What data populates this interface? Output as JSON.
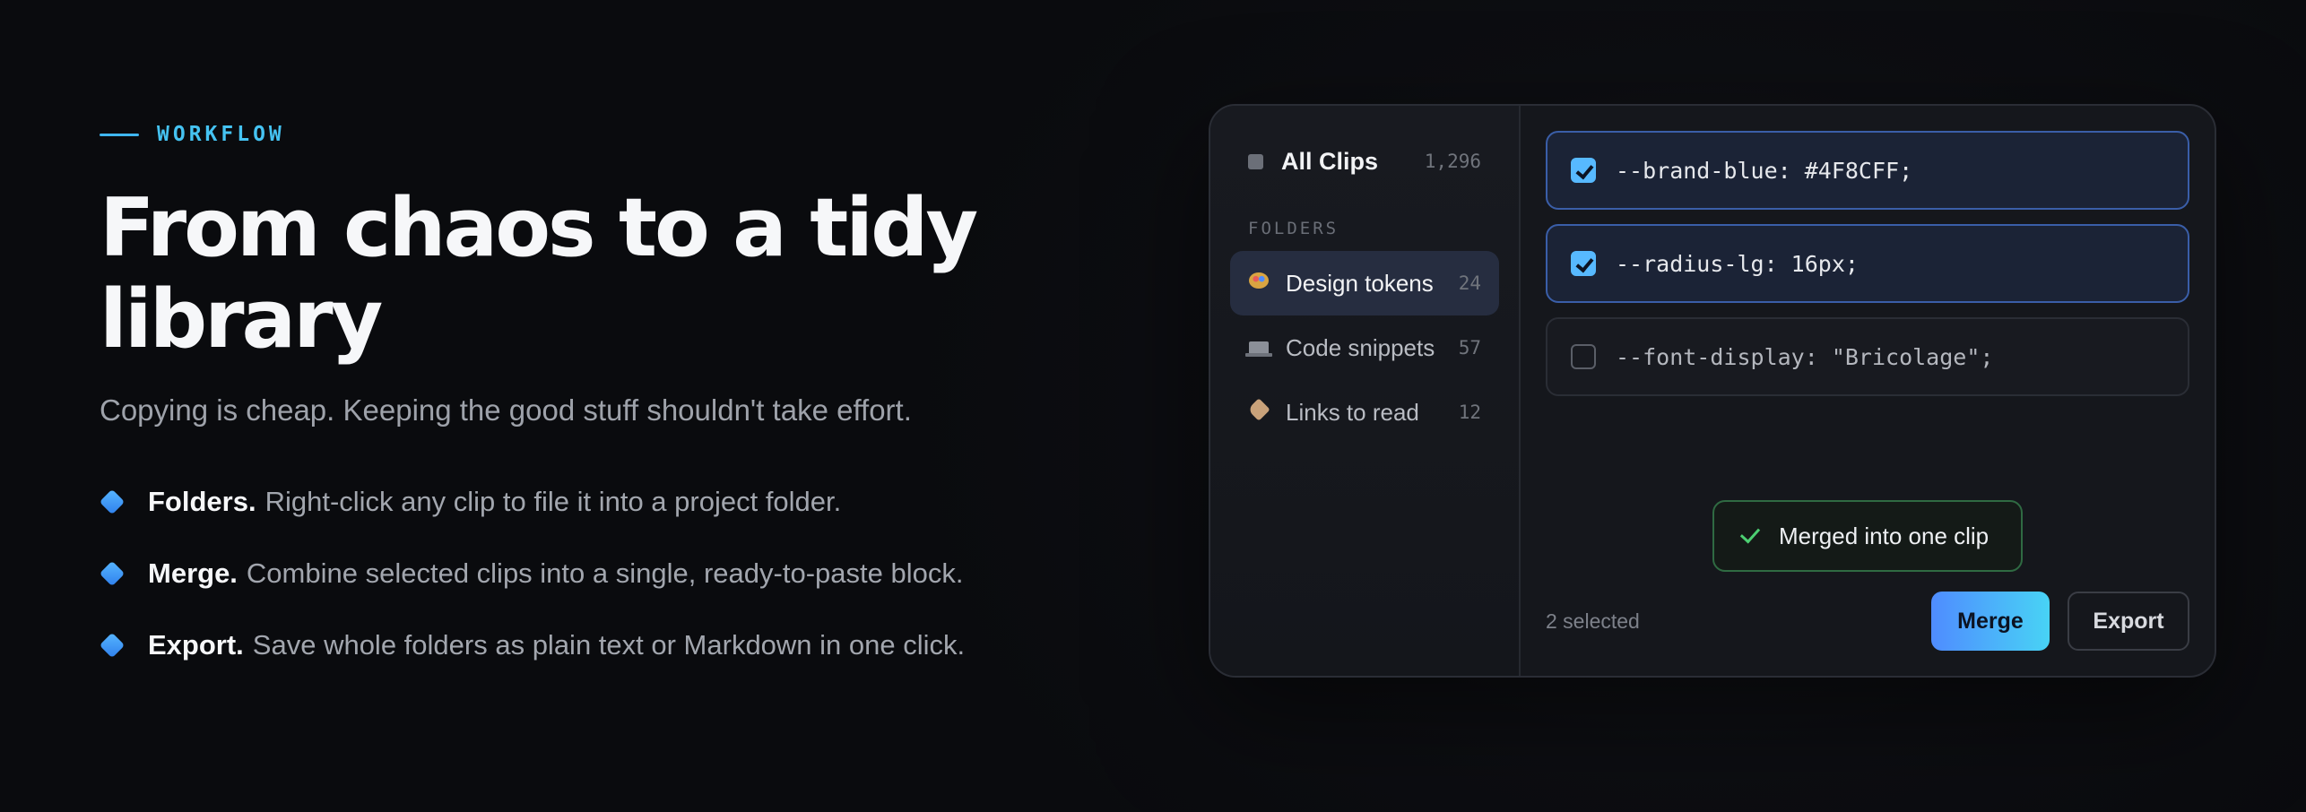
{
  "copy": {
    "eyebrow": "WORKFLOW",
    "headline": "From chaos to a tidy library",
    "subhead": "Copying is cheap. Keeping the good stuff shouldn't take effort.",
    "features": [
      {
        "title": "Folders.",
        "desc": "Right-click any clip to file it into a project folder."
      },
      {
        "title": "Merge.",
        "desc": "Combine selected clips into a single, ready-to-paste block."
      },
      {
        "title": "Export.",
        "desc": "Save whole folders as plain text or Markdown in one click."
      }
    ]
  },
  "sidebar": {
    "all_clips": {
      "label": "All Clips",
      "count": "1,296",
      "icon": "square-icon"
    },
    "section_label": "FOLDERS",
    "folders": [
      {
        "label": "Design tokens",
        "count": "24",
        "icon": "palette-icon",
        "active": true
      },
      {
        "label": "Code snippets",
        "count": "57",
        "icon": "laptop-icon",
        "active": false
      },
      {
        "label": "Links to read",
        "count": "12",
        "icon": "tag-icon",
        "active": false
      }
    ]
  },
  "clips": [
    {
      "text": "--brand-blue: #4F8CFF;",
      "checked": true
    },
    {
      "text": "--radius-lg: 16px;",
      "checked": true
    },
    {
      "text": "--font-display: \"Bricolage\";",
      "checked": false
    }
  ],
  "toast": {
    "text": "Merged into one clip",
    "icon": "check-icon"
  },
  "footer": {
    "selected_count": "2 selected",
    "merge_label": "Merge",
    "export_label": "Export"
  },
  "colors": {
    "accent": "#45C3F2",
    "merge_gradient_start": "#4F8CFF",
    "merge_gradient_end": "#48D3F5",
    "success": "#4CCF72"
  }
}
